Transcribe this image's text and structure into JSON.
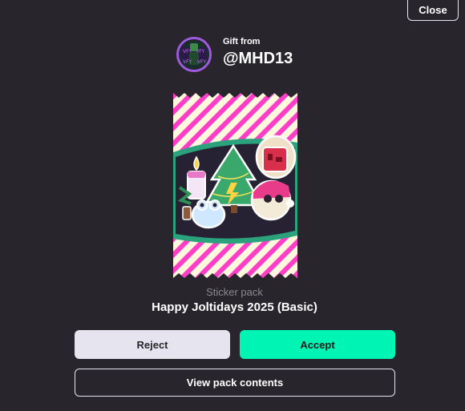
{
  "close_label": "Close",
  "sender": {
    "prefix": "Gift from",
    "username": "@MHD13"
  },
  "pack": {
    "type": "Sticker pack",
    "name": "Happy Joltidays 2025 (Basic)"
  },
  "actions": {
    "reject": "Reject",
    "accept": "Accept",
    "view_contents": "View pack contents"
  },
  "colors": {
    "background": "#28262c",
    "accept": "#00f5b4",
    "reject": "#e6e4ee",
    "wrapper_stripe": "#ff3ec8",
    "wrapper_cream": "#fdf9dc",
    "wrapper_rim": "#2aa37c"
  }
}
